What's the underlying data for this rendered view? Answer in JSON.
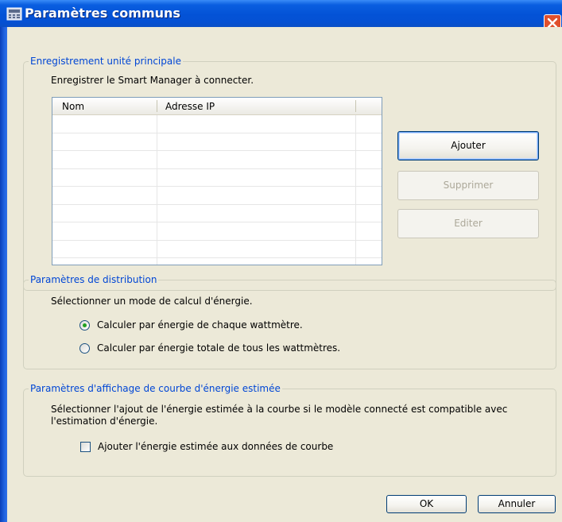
{
  "window": {
    "title": "Paramètres communs",
    "close_icon": "close-icon",
    "app_icon": "calculator-icon"
  },
  "registration": {
    "legend": "Enregistrement unité principale",
    "instruction": "Enregistrer le Smart Manager à connecter.",
    "list": {
      "columns": [
        "Nom",
        "Adresse IP"
      ],
      "rows": []
    },
    "buttons": {
      "add": "Ajouter",
      "delete": "Supprimer",
      "edit": "Editer"
    }
  },
  "distribution": {
    "legend": "Paramètres de distribution",
    "instruction": "Sélectionner un mode de calcul d'énergie.",
    "options": [
      {
        "label": "Calculer par énergie de chaque wattmètre.",
        "selected": true
      },
      {
        "label": "Calculer par énergie totale de tous les wattmètres.",
        "selected": false
      }
    ]
  },
  "curve": {
    "legend": "Paramètres d'affichage de courbe d'énergie estimée",
    "instruction_line1": "Sélectionner l'ajout de l'énergie estimée à la courbe si le modèle connecté est compatible avec",
    "instruction_line2": "l'estimation d'énergie.",
    "checkbox_label": "Ajouter l'énergie estimée aux données de courbe",
    "checked": false
  },
  "footer": {
    "ok": "OK",
    "cancel": "Annuler"
  },
  "colors": {
    "titlebar": "#0352d6",
    "legend_text": "#0046d5",
    "dialog_bg": "#ece9d8"
  }
}
